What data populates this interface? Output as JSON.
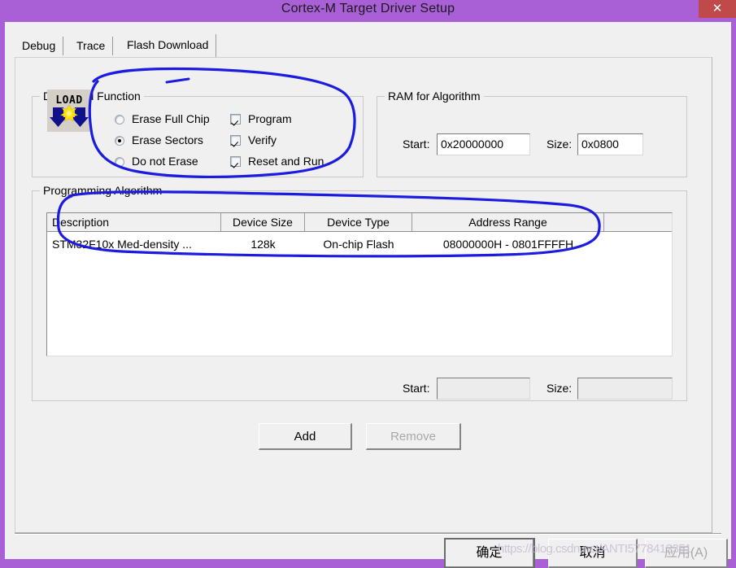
{
  "window": {
    "title": "Cortex-M Target Driver Setup",
    "close_label": "✕",
    "titlebar_color": "#a95fd6",
    "close_color": "#c04a4a"
  },
  "tabs": [
    {
      "label": "Debug",
      "active": false
    },
    {
      "label": "Trace",
      "active": false
    },
    {
      "label": "Flash Download",
      "active": true
    }
  ],
  "download_function": {
    "title": "Download Function",
    "icon": "load-icon",
    "erase_options": [
      {
        "label": "Erase Full Chip",
        "checked": false
      },
      {
        "label": "Erase Sectors",
        "checked": true
      },
      {
        "label": "Do not Erase",
        "checked": false
      }
    ],
    "flags": [
      {
        "label": "Program",
        "checked": true
      },
      {
        "label": "Verify",
        "checked": true
      },
      {
        "label": "Reset and Run",
        "checked": true
      }
    ]
  },
  "ram_for_algorithm": {
    "title": "RAM for Algorithm",
    "start_label": "Start:",
    "start_value": "0x20000000",
    "size_label": "Size:",
    "size_value": "0x0800"
  },
  "programming_algorithm": {
    "title": "Programming Algorithm",
    "columns": [
      "Description",
      "Device Size",
      "Device Type",
      "Address Range",
      ""
    ],
    "rows": [
      {
        "description": "STM32F10x Med-density ...",
        "device_size": "128k",
        "device_type": "On-chip Flash",
        "address_range": "08000000H - 0801FFFFH"
      }
    ],
    "start_label": "Start:",
    "start_value": "",
    "size_label": "Size:",
    "size_value": "",
    "add_label": "Add",
    "remove_label": "Remove"
  },
  "dialog_buttons": {
    "ok": "确定",
    "cancel": "取消",
    "apply": "应用(A)"
  },
  "annotation": {
    "color": "#1c1ce0",
    "description": "hand-drawn blue ellipse around erase/flag options and another around the algorithm table row"
  },
  "watermark": "https://blog.csdn.net/ANTI5778412351"
}
